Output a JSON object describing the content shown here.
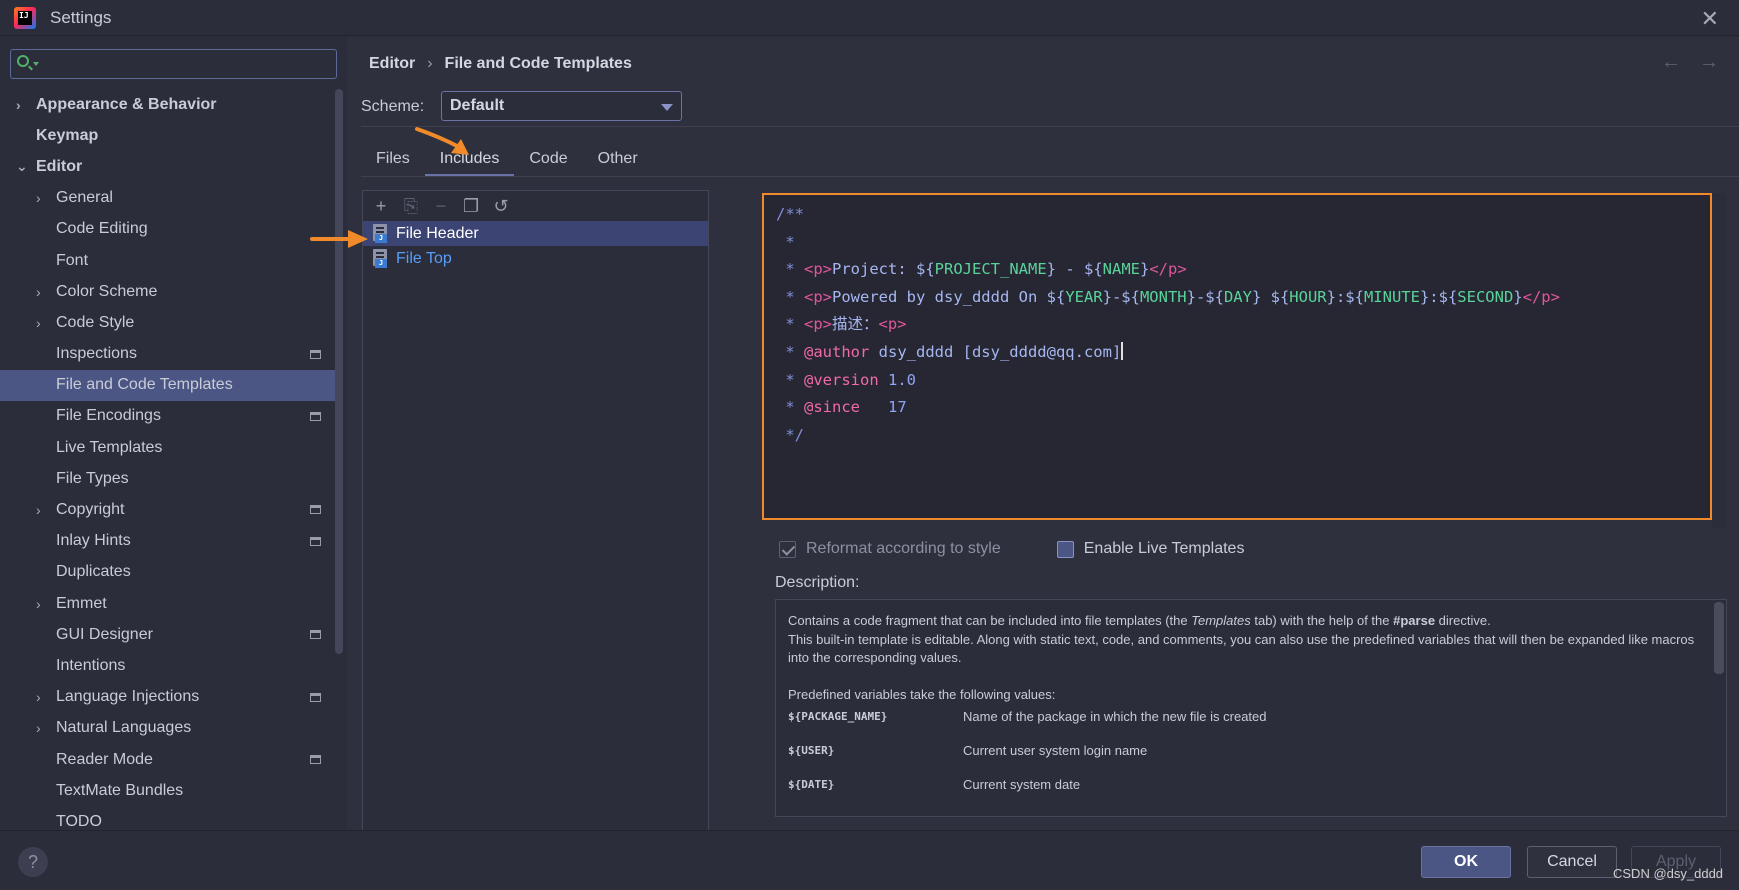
{
  "window": {
    "title": "Settings"
  },
  "search": {
    "placeholder": "",
    "value": ""
  },
  "sidebar": {
    "items": [
      {
        "label": "Appearance & Behavior",
        "level": 0,
        "expandable": true,
        "expanded": false,
        "bold": true
      },
      {
        "label": "Keymap",
        "level": 0,
        "expandable": false,
        "bold": true
      },
      {
        "label": "Editor",
        "level": 0,
        "expandable": true,
        "expanded": true,
        "bold": true
      },
      {
        "label": "General",
        "level": 1,
        "expandable": true
      },
      {
        "label": "Code Editing",
        "level": 1
      },
      {
        "label": "Font",
        "level": 1
      },
      {
        "label": "Color Scheme",
        "level": 1,
        "expandable": true
      },
      {
        "label": "Code Style",
        "level": 1,
        "expandable": true
      },
      {
        "label": "Inspections",
        "level": 1,
        "modified": true
      },
      {
        "label": "File and Code Templates",
        "level": 1,
        "selected": true
      },
      {
        "label": "File Encodings",
        "level": 1,
        "modified": true
      },
      {
        "label": "Live Templates",
        "level": 1
      },
      {
        "label": "File Types",
        "level": 1
      },
      {
        "label": "Copyright",
        "level": 1,
        "expandable": true,
        "modified": true
      },
      {
        "label": "Inlay Hints",
        "level": 1,
        "modified": true
      },
      {
        "label": "Duplicates",
        "level": 1
      },
      {
        "label": "Emmet",
        "level": 1,
        "expandable": true
      },
      {
        "label": "GUI Designer",
        "level": 1,
        "modified": true
      },
      {
        "label": "Intentions",
        "level": 1
      },
      {
        "label": "Language Injections",
        "level": 1,
        "expandable": true,
        "modified": true
      },
      {
        "label": "Natural Languages",
        "level": 1,
        "expandable": true
      },
      {
        "label": "Reader Mode",
        "level": 1,
        "modified": true
      },
      {
        "label": "TextMate Bundles",
        "level": 1
      },
      {
        "label": "TODO",
        "level": 1
      }
    ]
  },
  "breadcrumb": {
    "parent": "Editor",
    "separator": "›",
    "current": "File and Code Templates"
  },
  "nav": {
    "back": "←",
    "forward": "→"
  },
  "scheme": {
    "label": "Scheme:",
    "value": "Default"
  },
  "tabs": [
    {
      "label": "Files",
      "active": false
    },
    {
      "label": "Includes",
      "active": true
    },
    {
      "label": "Code",
      "active": false
    },
    {
      "label": "Other",
      "active": false
    }
  ],
  "templates": [
    {
      "label": "File Header",
      "selected": true
    },
    {
      "label": "File Top",
      "selected": false
    }
  ],
  "icons": {
    "add": "plus-icon",
    "copy": "copy-icon",
    "remove": "minus-icon",
    "duplicate": "duplicate-icon",
    "reset": "undo-icon",
    "file": "java-file-icon",
    "search": "search-icon",
    "help": "help-icon",
    "close": "close-icon"
  },
  "editor": {
    "lines": [
      [
        {
          "t": "/**",
          "c": "com"
        }
      ],
      [
        {
          "t": " *",
          "c": "com"
        }
      ],
      [
        {
          "t": " * ",
          "c": "com"
        },
        {
          "t": "<p>",
          "c": "tag"
        },
        {
          "t": "Project: ",
          "c": "txt"
        },
        {
          "t": "${",
          "c": "txt"
        },
        {
          "t": "PROJECT_NAME",
          "c": "var"
        },
        {
          "t": "} - ${",
          "c": "txt"
        },
        {
          "t": "NAME",
          "c": "var"
        },
        {
          "t": "}",
          "c": "txt"
        },
        {
          "t": "</p>",
          "c": "tag"
        }
      ],
      [
        {
          "t": " * ",
          "c": "com"
        },
        {
          "t": "<p>",
          "c": "tag"
        },
        {
          "t": "Powered by dsy_dddd On ",
          "c": "txt"
        },
        {
          "t": "${",
          "c": "txt"
        },
        {
          "t": "YEAR",
          "c": "var"
        },
        {
          "t": "}-${",
          "c": "txt"
        },
        {
          "t": "MONTH",
          "c": "var"
        },
        {
          "t": "}-${",
          "c": "txt"
        },
        {
          "t": "DAY",
          "c": "var"
        },
        {
          "t": "} ${",
          "c": "txt"
        },
        {
          "t": "HOUR",
          "c": "var"
        },
        {
          "t": "}:${",
          "c": "txt"
        },
        {
          "t": "MINUTE",
          "c": "var"
        },
        {
          "t": "}:${",
          "c": "txt"
        },
        {
          "t": "SECOND",
          "c": "var"
        },
        {
          "t": "}",
          "c": "txt"
        },
        {
          "t": "</p>",
          "c": "tag"
        }
      ],
      [
        {
          "t": " * ",
          "c": "com"
        },
        {
          "t": "<p>",
          "c": "tag"
        },
        {
          "t": "描述：",
          "c": "txt"
        },
        {
          "t": "<p>",
          "c": "tag"
        }
      ],
      [
        {
          "t": " * ",
          "c": "com"
        },
        {
          "t": "@author",
          "c": "kw"
        },
        {
          "t": " dsy_dddd [dsy_dddd@qq.com]",
          "c": "txt"
        },
        {
          "t": "",
          "c": "cursor"
        }
      ],
      [
        {
          "t": " * ",
          "c": "com"
        },
        {
          "t": "@version",
          "c": "kw"
        },
        {
          "t": " 1.0",
          "c": "num"
        }
      ],
      [
        {
          "t": " * ",
          "c": "com"
        },
        {
          "t": "@since",
          "c": "kw"
        },
        {
          "t": "   17",
          "c": "num"
        }
      ],
      [
        {
          "t": " */",
          "c": "com"
        }
      ]
    ]
  },
  "options": {
    "reformat": {
      "label": "Reformat according to style",
      "checked": true,
      "enabled": false
    },
    "live_templates": {
      "label": "Enable Live Templates",
      "checked": false,
      "enabled": true
    }
  },
  "description": {
    "label": "Description:",
    "p1_a": "Contains a code fragment that can be included into file templates (the ",
    "p1_em": "Templates",
    "p1_b": " tab) with the help of the ",
    "p1_strong": "#parse",
    "p1_c": " directive.",
    "p2": "This built-in template is editable. Along with static text, code, and comments, you can also use the predefined variables that will then be expanded like macros into the corresponding values.",
    "p3": "Predefined variables take the following values:",
    "vars": [
      {
        "name": "${PACKAGE_NAME}",
        "desc": "Name of the package in which the new file is created"
      },
      {
        "name": "${USER}",
        "desc": "Current user system login name"
      },
      {
        "name": "${DATE}",
        "desc": "Current system date"
      }
    ]
  },
  "buttons": {
    "help": "?",
    "ok": "OK",
    "cancel": "Cancel",
    "apply": "Apply"
  },
  "watermark": "CSDN @dsy_dddd",
  "colors": {
    "accent": "#4c5684",
    "highlight_border": "#f08a2b",
    "annotation_arrow": "#f08a2b"
  }
}
